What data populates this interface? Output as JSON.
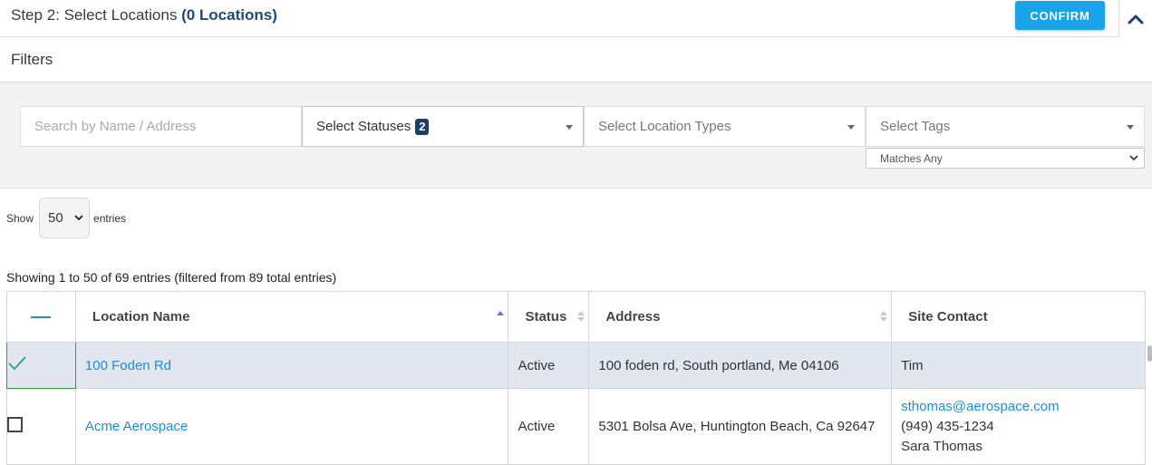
{
  "header": {
    "title": "Step 2: Select Locations",
    "count": "(0 Locations)",
    "confirm_label": "CONFIRM",
    "collapse_icon": "chevron-up-icon"
  },
  "filters": {
    "title": "Filters",
    "search_placeholder": "Search by Name / Address",
    "statuses_label": "Select Statuses",
    "statuses_badge": "2",
    "location_types_label": "Select Location Types",
    "tags_label": "Select Tags",
    "tag_match_mode": "Matches Any"
  },
  "length": {
    "show_label": "Show",
    "value": "50",
    "entries_label": "entries"
  },
  "info": "Showing 1 to 50 of 69 entries (filtered from 89 total entries)",
  "table": {
    "columns": [
      "Location Name",
      "Status",
      "Address",
      "Site Contact"
    ],
    "sorted_column": "Location Name",
    "sort_direction": "asc",
    "rows": [
      {
        "selected": true,
        "name": "100 Foden Rd",
        "status": "Active",
        "address": "100 foden rd, South portland, Me 04106",
        "contact_email": "",
        "contact_phone": "",
        "contact_name": "Tim"
      },
      {
        "selected": false,
        "name": "Acme Aerospace",
        "status": "Active",
        "address": "5301 Bolsa Ave, Huntington Beach, Ca 92647",
        "contact_email": "sthomas@aerospace.com",
        "contact_phone": "(949) 435-1234",
        "contact_name": "Sara Thomas"
      }
    ]
  },
  "colors": {
    "accent": "#1aa3e8",
    "link": "#1b8fd6",
    "count_text": "#1e4a7a",
    "badge": "#1d3d66",
    "selected_row": "#e1e6ef",
    "check": "#2a9d8f"
  }
}
